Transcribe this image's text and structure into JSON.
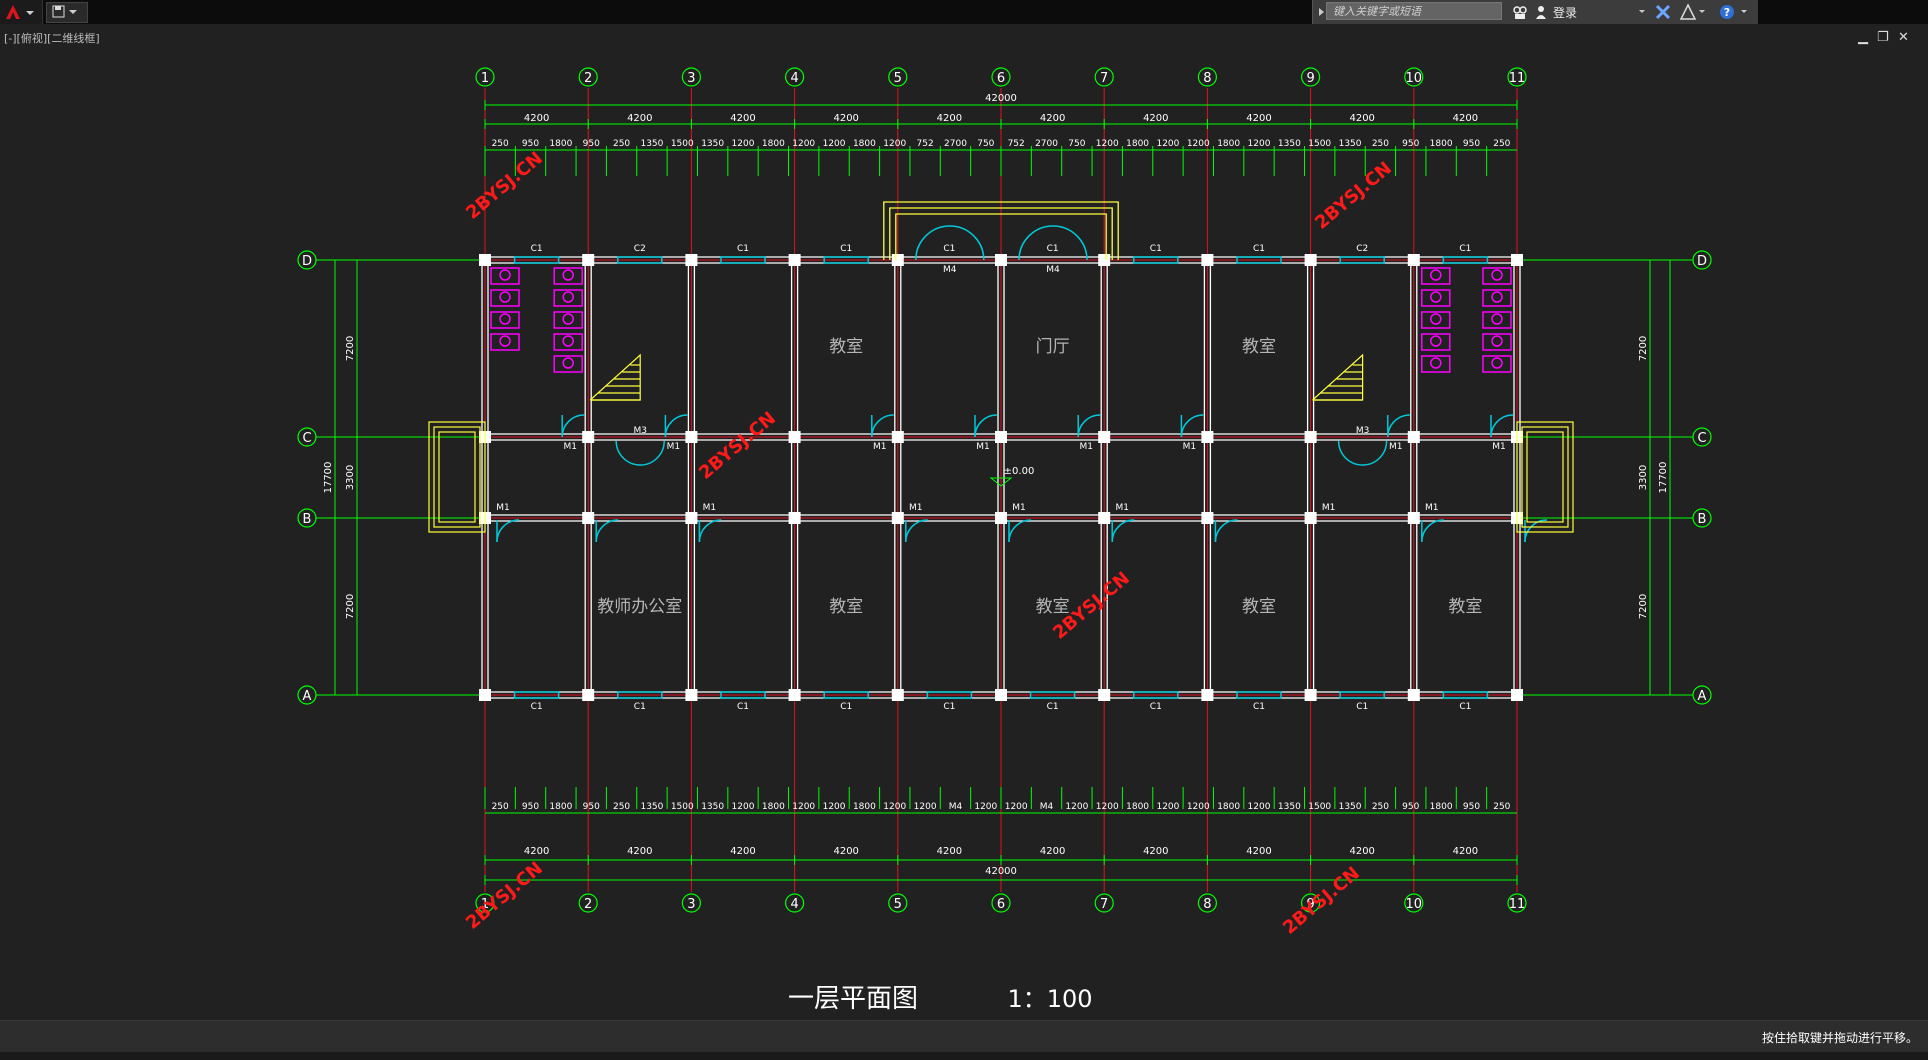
{
  "header": {
    "search_placeholder": "键入关键字或短语",
    "login_label": "登录",
    "help_icon": "help-icon"
  },
  "view": {
    "viewport_label": "[-][俯视][二维线框]"
  },
  "window_controls": {
    "minimize": "▁",
    "restore": "❐",
    "close": "✕"
  },
  "drawing": {
    "title": "一层平面图",
    "scale": "1：100",
    "grid_columns": [
      "1",
      "2",
      "3",
      "4",
      "5",
      "6",
      "7",
      "8",
      "9",
      "10",
      "11"
    ],
    "grid_rows": [
      "D",
      "C",
      "B",
      "A"
    ],
    "overall_length": "42000",
    "bay_dims": [
      "4200",
      "4200",
      "4200",
      "4200",
      "4200",
      "4200",
      "4200",
      "4200",
      "4200",
      "4200"
    ],
    "detail_dims_top": [
      "250",
      "950",
      "1800",
      "950",
      "250",
      "1350",
      "1500",
      "1350",
      "1200",
      "1800",
      "1200",
      "1200",
      "1800",
      "1200",
      "752",
      "2700",
      "750",
      "752",
      "2700",
      "750",
      "1200",
      "1800",
      "1200",
      "1200",
      "1800",
      "1200",
      "1350",
      "1500",
      "1350",
      "250",
      "950",
      "1800",
      "950",
      "250"
    ],
    "detail_dims_bottom": [
      "250",
      "950",
      "1800",
      "950",
      "250",
      "1350",
      "1500",
      "1350",
      "1200",
      "1800",
      "1200",
      "1200",
      "1800",
      "1200",
      "1200",
      "M4",
      "1200",
      "1200",
      "M4",
      "1200",
      "1200",
      "1800",
      "1200",
      "1200",
      "1800",
      "1200",
      "1350",
      "1500",
      "1350",
      "250",
      "950",
      "1800",
      "950",
      "250"
    ],
    "vertical_dims": {
      "top": "7200",
      "mid": "3300",
      "bottom": "7200",
      "total": "17700"
    },
    "rooms": [
      {
        "name": "教室",
        "col": 3.5,
        "row": "top"
      },
      {
        "name": "门厅",
        "col": 5.5,
        "row": "top"
      },
      {
        "name": "教室",
        "col": 7.5,
        "row": "top"
      },
      {
        "name": "教师办公室",
        "col": 1.5,
        "row": "bottom"
      },
      {
        "name": "教室",
        "col": 3.5,
        "row": "bottom"
      },
      {
        "name": "教室",
        "col": 5.5,
        "row": "bottom"
      },
      {
        "name": "教室",
        "col": 7.5,
        "row": "bottom"
      },
      {
        "name": "教室",
        "col": 9.5,
        "row": "bottom"
      }
    ],
    "elevation_mark": "±0.00",
    "window_tags": {
      "c1": "C1",
      "c2": "C2",
      "m1": "M1",
      "m3": "M3",
      "m4": "M4"
    },
    "watermark": "2BYSJ.CN"
  },
  "status": {
    "message": "按住拾取键并拖动进行平移。"
  },
  "colors": {
    "background": "#212121",
    "grid_axis": "#e0141e",
    "dimension": "#00ff00",
    "wall": "#ffffff",
    "window": "#00c8d8",
    "stair": "#ffff3c",
    "fixture": "#ff00ff",
    "watermark": "#ff1a1a"
  }
}
